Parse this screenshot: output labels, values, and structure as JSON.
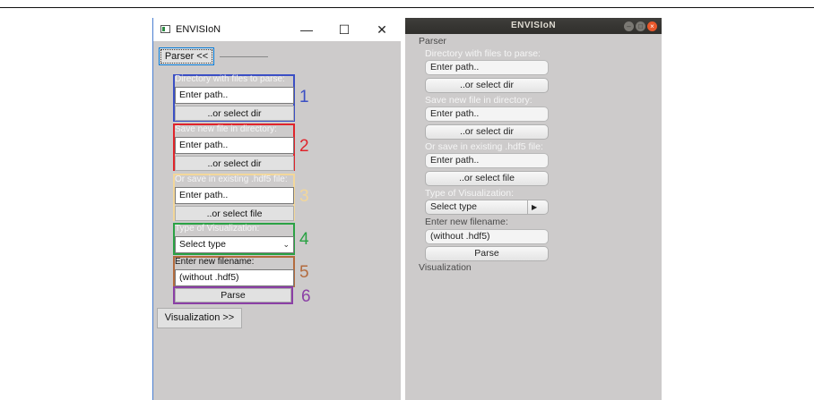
{
  "left_window": {
    "title": "ENVISIoN",
    "controls": {
      "minimize": "—",
      "maximize": "☐",
      "close": "✕"
    },
    "parser_button": "Parser <<",
    "groups": [
      {
        "label": "Directory with files to parse:",
        "input": "Enter path..",
        "button": "..or select dir",
        "number": "1",
        "color": "#3b4fc4"
      },
      {
        "label": "Save new file in directory:",
        "input": "Enter path..",
        "button": "..or select dir",
        "number": "2",
        "color": "#e0242b"
      },
      {
        "label": "Or save in existing .hdf5 file:",
        "input": "Enter path..",
        "button": "..or select file",
        "number": "3",
        "color": "#f3d79a"
      },
      {
        "label": "Type of Visualization:",
        "select": "Select type",
        "number": "4",
        "color": "#2aa244"
      },
      {
        "label": "Enter new filename:",
        "input": "(without .hdf5)",
        "number": "5",
        "color": "#b36b3e"
      },
      {
        "button": "Parse",
        "number": "6",
        "color": "#8b3fa6"
      }
    ],
    "visualization_button": "Visualization >>"
  },
  "right_window": {
    "title": "ENVISIoN",
    "parser_label": "Parser",
    "dir_label": "Directory with files to parse:",
    "dir_input": "Enter path..",
    "dir_button": "..or select dir",
    "save_label": "Save new file in directory:",
    "save_input": "Enter path..",
    "save_button": "..or select dir",
    "existing_label": "Or save in existing .hdf5 file:",
    "existing_input": "Enter path..",
    "existing_button": "..or select file",
    "type_label": "Type of Visualization:",
    "type_select": "Select type",
    "filename_label": "Enter new filename:",
    "filename_input": "(without .hdf5)",
    "parse_button": "Parse",
    "visualization_label": "Visualization"
  }
}
